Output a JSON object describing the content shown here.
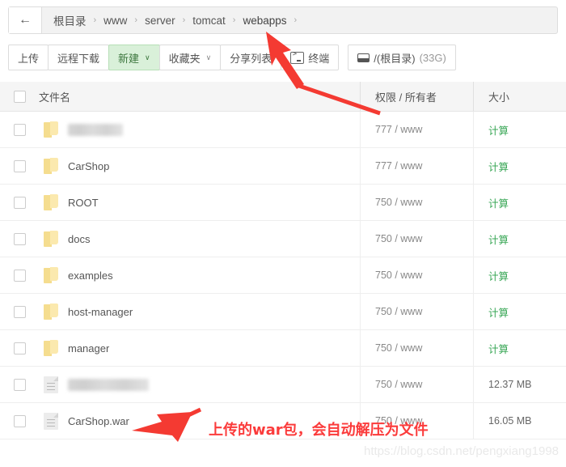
{
  "breadcrumb": {
    "back_icon": "arrow-left-icon",
    "separator": "›",
    "items": [
      "根目录",
      "www",
      "server",
      "tomcat",
      "webapps"
    ]
  },
  "toolbar": {
    "upload": "上传",
    "remote_download": "远程下载",
    "new": "新建",
    "favorites": "收藏夹",
    "share_list": "分享列表",
    "terminal": "终端",
    "disk": "/(根目录)",
    "disk_size": "(33G)",
    "caret": "∨"
  },
  "table": {
    "headers": {
      "name": "文件名",
      "permission": "权限 / 所有者",
      "size": "大小"
    },
    "rows": [
      {
        "name": "",
        "blurred": true,
        "type": "folder",
        "perm": "777 / www",
        "size": "计算",
        "size_is_link": true
      },
      {
        "name": "CarShop",
        "blurred": false,
        "type": "folder",
        "perm": "777 / www",
        "size": "计算",
        "size_is_link": true
      },
      {
        "name": "ROOT",
        "blurred": false,
        "type": "folder",
        "perm": "750 / www",
        "size": "计算",
        "size_is_link": true
      },
      {
        "name": "docs",
        "blurred": false,
        "type": "folder",
        "perm": "750 / www",
        "size": "计算",
        "size_is_link": true
      },
      {
        "name": "examples",
        "blurred": false,
        "type": "folder",
        "perm": "750 / www",
        "size": "计算",
        "size_is_link": true
      },
      {
        "name": "host-manager",
        "blurred": false,
        "type": "folder",
        "perm": "750 / www",
        "size": "计算",
        "size_is_link": true
      },
      {
        "name": "manager",
        "blurred": false,
        "type": "folder",
        "perm": "750 / www",
        "size": "计算",
        "size_is_link": true
      },
      {
        "name": "",
        "blurred": true,
        "type": "file",
        "perm": "750 / www",
        "size": "12.37 MB",
        "size_is_link": false
      },
      {
        "name": "CarShop.war",
        "blurred": false,
        "type": "file",
        "perm": "750 / www",
        "size": "16.05 MB",
        "size_is_link": false
      }
    ]
  },
  "annotations": {
    "note": "上传的war包，会自动解压为文件",
    "arrow_color": "#f43a32"
  },
  "watermark": "https://blog.csdn.net/pengxiang1998"
}
